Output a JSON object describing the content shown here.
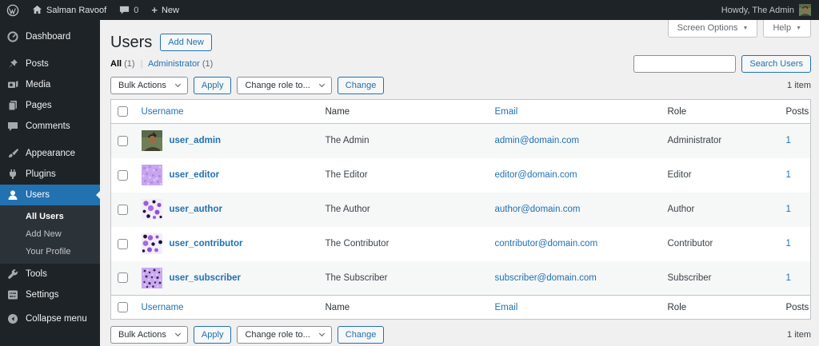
{
  "admin_bar": {
    "site_name": "Salman Ravoof",
    "comments_count": "0",
    "new_label": "New",
    "howdy": "Howdy, The Admin"
  },
  "icons": {
    "plus": "+",
    "chevron_down": "▼",
    "separator": "|"
  },
  "sidebar": {
    "items": [
      {
        "label": "Dashboard"
      },
      {
        "label": "Posts"
      },
      {
        "label": "Media"
      },
      {
        "label": "Pages"
      },
      {
        "label": "Comments"
      },
      {
        "label": "Appearance"
      },
      {
        "label": "Plugins"
      },
      {
        "label": "Users"
      },
      {
        "label": "Tools"
      },
      {
        "label": "Settings"
      },
      {
        "label": "Collapse menu"
      }
    ],
    "submenu": [
      "All Users",
      "Add New",
      "Your Profile"
    ]
  },
  "header": {
    "title": "Users",
    "add_new": "Add New",
    "screen_options": "Screen Options",
    "help": "Help"
  },
  "filters": {
    "all_label": "All",
    "all_count": "(1)",
    "admin_label": "Administrator",
    "admin_count": "(1)"
  },
  "search": {
    "button": "Search Users",
    "value": ""
  },
  "toolbar": {
    "bulk_actions": "Bulk Actions",
    "apply": "Apply",
    "change_role": "Change role to...",
    "change": "Change",
    "item_count": "1 item"
  },
  "table": {
    "headers": [
      "Username",
      "Name",
      "Email",
      "Role",
      "Posts"
    ],
    "rows": [
      {
        "username": "user_admin",
        "name": "The Admin",
        "email": "admin@domain.com",
        "role": "Administrator",
        "posts": "1"
      },
      {
        "username": "user_editor",
        "name": "The Editor",
        "email": "editor@domain.com",
        "role": "Editor",
        "posts": "1"
      },
      {
        "username": "user_author",
        "name": "The Author",
        "email": "author@domain.com",
        "role": "Author",
        "posts": "1"
      },
      {
        "username": "user_contributor",
        "name": "The Contributor",
        "email": "contributor@domain.com",
        "role": "Contributor",
        "posts": "1"
      },
      {
        "username": "user_subscriber",
        "name": "The Subscriber",
        "email": "subscriber@domain.com",
        "role": "Subscriber",
        "posts": "1"
      }
    ]
  },
  "colors": {
    "accent_blue": "#2271b1",
    "admin_bar_bg": "#1d2327",
    "sidebar_bg": "#1d2327",
    "submenu_bg": "#2c3338",
    "content_bg": "#f0f0f1",
    "stripe_bg": "#f6f7f7",
    "border": "#c3c4c7"
  }
}
